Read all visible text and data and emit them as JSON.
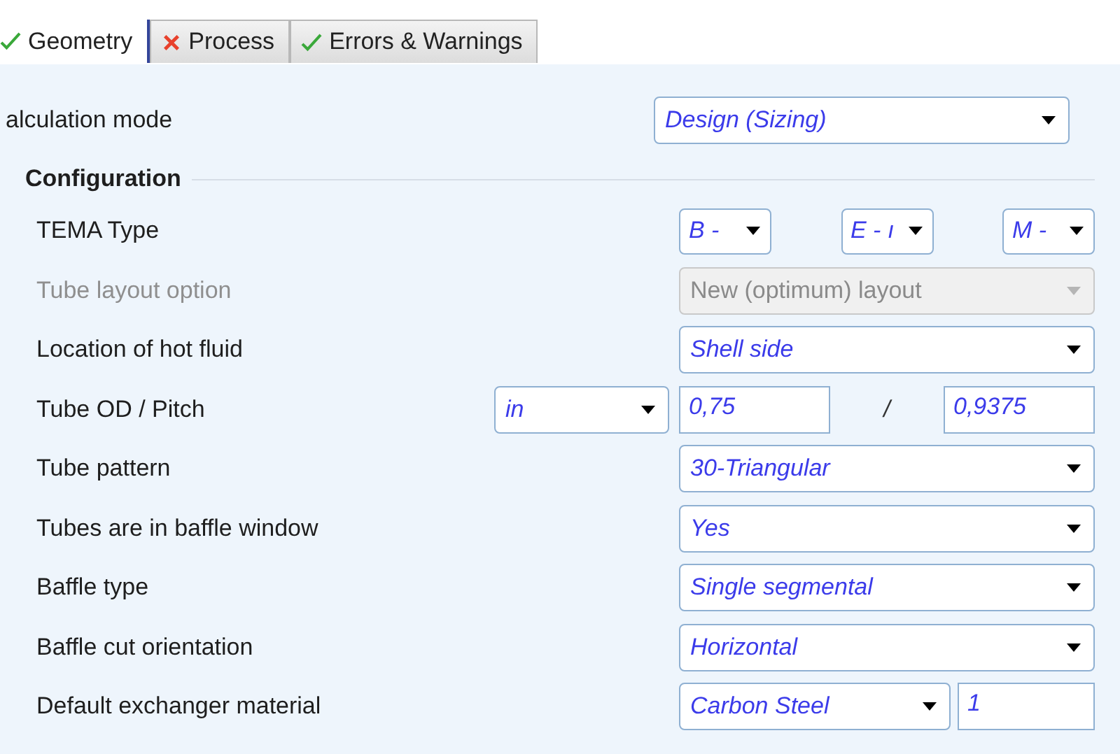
{
  "tabs": [
    {
      "label": "Geometry",
      "kind": "ok",
      "selected": true
    },
    {
      "label": "Process",
      "kind": "error",
      "selected": false
    },
    {
      "label": "Errors & Warnings",
      "kind": "ok",
      "selected": false
    }
  ],
  "calculation_mode": {
    "label": "alculation mode",
    "value": "Design (Sizing)"
  },
  "section": {
    "title": "Configuration"
  },
  "rows": [
    {
      "kind": "tema",
      "label": "TEMA Type",
      "values": [
        "B -",
        "E - ı",
        "M -"
      ],
      "disabled": false
    },
    {
      "kind": "combo",
      "label": "Tube layout option",
      "value": "New (optimum) layout",
      "disabled": true
    },
    {
      "kind": "combo",
      "label": "Location of hot fluid",
      "value": "Shell side",
      "disabled": false
    },
    {
      "kind": "od-pitch",
      "label": "Tube OD / Pitch",
      "unit": "in",
      "od": "0,75",
      "separator": "/",
      "pitch": "0,9375",
      "disabled": false
    },
    {
      "kind": "combo",
      "label": "Tube pattern",
      "value": "30-Triangular",
      "disabled": false
    },
    {
      "kind": "combo",
      "label": "Tubes are in baffle window",
      "value": "Yes",
      "disabled": false
    },
    {
      "kind": "combo",
      "label": "Baffle type",
      "value": "Single segmental",
      "disabled": false
    },
    {
      "kind": "combo",
      "label": "Baffle cut orientation",
      "value": "Horizontal",
      "disabled": false
    },
    {
      "kind": "material",
      "label": "Default exchanger material",
      "value": "Carbon Steel",
      "number": "1",
      "disabled": false
    }
  ]
}
